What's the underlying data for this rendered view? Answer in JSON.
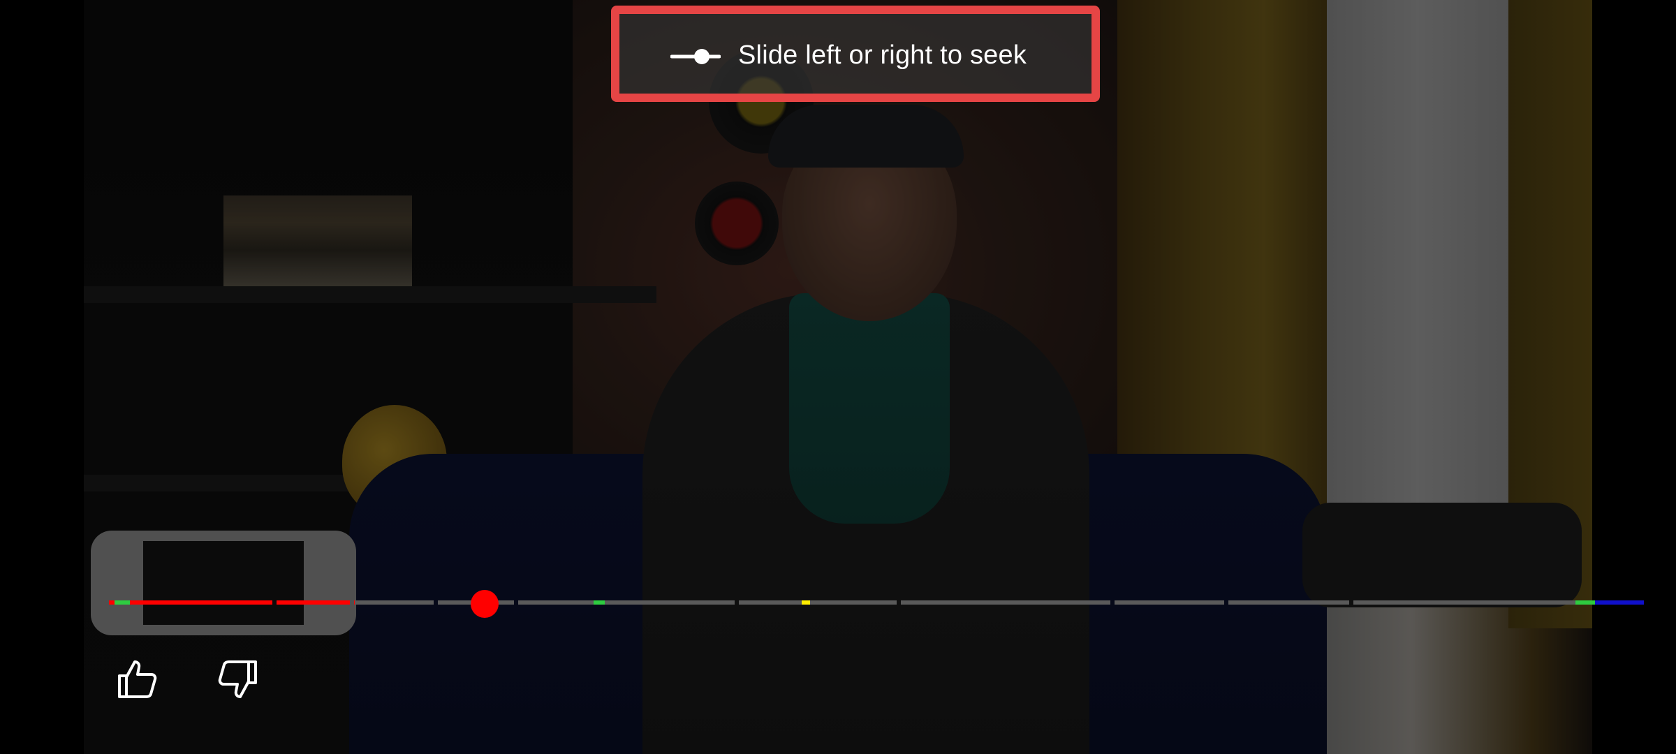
{
  "seek_hint": {
    "text": "Slide left or right to seek",
    "icon": "slider-icon",
    "border_color": "#e64545"
  },
  "player": {
    "progress_fraction": 0.16,
    "played_color": "#ff0000",
    "unplayed_color": "#5a5a5a",
    "thumb_color": "#ff0000"
  },
  "actions": {
    "like_icon": "thumbs-up-icon",
    "dislike_icon": "thumbs-down-icon"
  }
}
